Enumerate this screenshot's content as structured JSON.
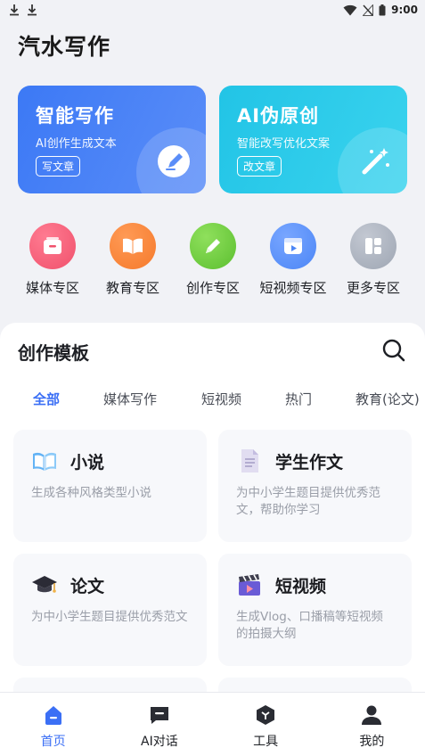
{
  "status": {
    "time": "9:00"
  },
  "app": {
    "title": "汽水写作"
  },
  "feature_cards": [
    {
      "title": "智能写作",
      "subtitle": "AI创作生成文本",
      "button": "写文章"
    },
    {
      "title": "AI伪原创",
      "subtitle": "智能改写优化文案",
      "button": "改文章"
    }
  ],
  "zones": [
    {
      "label": "媒体专区",
      "color": "#f0516c"
    },
    {
      "label": "教育专区",
      "color": "#f57a2c"
    },
    {
      "label": "创作专区",
      "color": "#6bcb3c"
    },
    {
      "label": "短视频专区",
      "color": "#4c86f6"
    },
    {
      "label": "更多专区",
      "color": "#a7aeba"
    }
  ],
  "templates": {
    "title": "创作模板",
    "tabs": [
      "全部",
      "媒体写作",
      "短视频",
      "热门",
      "教育(论文)"
    ],
    "active_tab": "全部",
    "items": [
      {
        "title": "小说",
        "desc": "生成各种风格类型小说",
        "icon": "book-icon"
      },
      {
        "title": "学生作文",
        "desc": "为中小学生题目提供优秀范文，帮助你学习",
        "icon": "document-icon"
      },
      {
        "title": "论文",
        "desc": "为中小学生题目提供优秀范文",
        "icon": "graduation-cap-icon"
      },
      {
        "title": "短视频",
        "desc": "生成Vlog、口播稿等短视频的拍摄大纲",
        "icon": "clapperboard-icon"
      }
    ]
  },
  "nav": [
    {
      "label": "首页",
      "icon": "home-icon",
      "active": true
    },
    {
      "label": "AI对话",
      "icon": "chat-icon",
      "active": false
    },
    {
      "label": "工具",
      "icon": "toolbox-icon",
      "active": false
    },
    {
      "label": "我的",
      "icon": "user-icon",
      "active": false
    }
  ],
  "colors": {
    "accent": "#3b6ff5"
  }
}
